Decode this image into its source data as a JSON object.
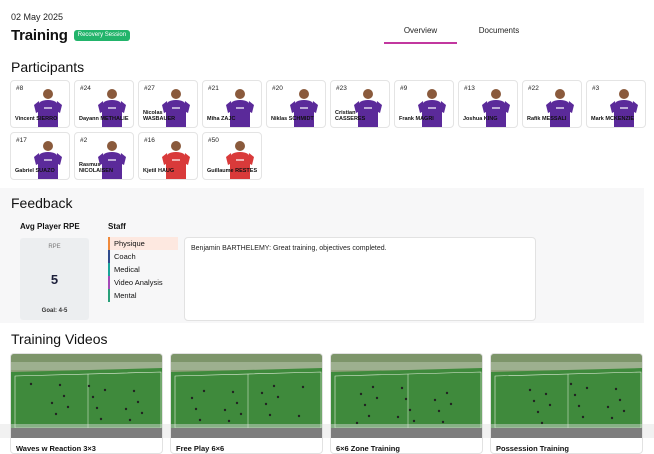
{
  "header": {
    "date": "02 May 2025",
    "title": "Training",
    "badge": "Recovery Session"
  },
  "tabs": [
    {
      "label": "Overview",
      "active": true
    },
    {
      "label": "Documents",
      "active": false
    }
  ],
  "participants": {
    "title": "Participants",
    "items": [
      {
        "number": "#8",
        "name": "Vincent SIERRO",
        "kit": "purple"
      },
      {
        "number": "#24",
        "name": "Dayann METHALIE",
        "kit": "purple"
      },
      {
        "number": "#27",
        "name": "Nicolas WASBAUER",
        "kit": "purple"
      },
      {
        "number": "#21",
        "name": "Miha ZAJC",
        "kit": "purple"
      },
      {
        "number": "#20",
        "name": "Niklas SCHMIDT",
        "kit": "purple"
      },
      {
        "number": "#23",
        "name": "Cristian CASSERES",
        "kit": "purple"
      },
      {
        "number": "#9",
        "name": "Frank MAGRI",
        "kit": "purple"
      },
      {
        "number": "#13",
        "name": "Joshua KING",
        "kit": "purple"
      },
      {
        "number": "#22",
        "name": "Rafik MESSALI",
        "kit": "purple"
      },
      {
        "number": "#3",
        "name": "Mark MCKENZIE",
        "kit": "purple"
      },
      {
        "number": "#17",
        "name": "Gabriel SUAZO",
        "kit": "purple"
      },
      {
        "number": "#2",
        "name": "Rasmus NICOLAISEN",
        "kit": "purple"
      },
      {
        "number": "#16",
        "name": "Kjetil HAUG",
        "kit": "red"
      },
      {
        "number": "#50",
        "name": "Guillaume RESTES",
        "kit": "red"
      }
    ]
  },
  "feedback": {
    "title": "Feedback",
    "avg_rpe_label": "Avg Player RPE",
    "rpe_label": "RPE",
    "rpe_value": "5",
    "goal": "Goal: 4-5",
    "staff_label": "Staff",
    "staff": [
      {
        "label": "Physique",
        "color": "#f08a3c",
        "active": true
      },
      {
        "label": "Coach",
        "color": "#2f4b8c",
        "active": false
      },
      {
        "label": "Medical",
        "color": "#1aa39a",
        "active": false
      },
      {
        "label": "Video Analysis",
        "color": "#a34bb7",
        "active": false
      },
      {
        "label": "Mental",
        "color": "#2aa07a",
        "active": false
      }
    ],
    "comment": "Benjamin BARTHELEMY: Great training, objectives completed."
  },
  "videos": {
    "title": "Training Videos",
    "items": [
      {
        "title": "Waves w Reaction 3×3"
      },
      {
        "title": "Free Play 6×6"
      },
      {
        "title": "6×6 Zone Training"
      },
      {
        "title": "Possession Training"
      }
    ]
  },
  "colors": {
    "accent": "#c2379f",
    "badge": "#22b46b",
    "kit_purple": "#5b2a9a",
    "kit_red": "#d93a3a"
  }
}
